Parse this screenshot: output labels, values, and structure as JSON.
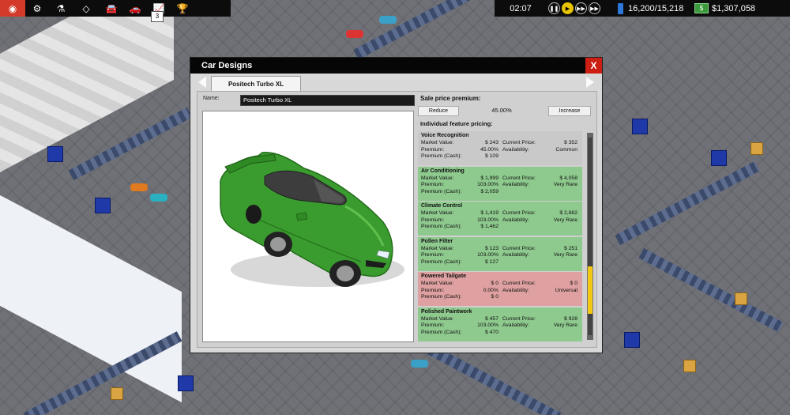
{
  "hud": {
    "badge": "3",
    "time": "02:07",
    "power": "16,200/15,218",
    "cash": "$1,307,058",
    "speed_icons": [
      "pause-icon",
      "play-icon",
      "fast-forward-icon",
      "faster-forward-icon"
    ],
    "left_icons": [
      "logo-icon",
      "gear-icon",
      "research-icon",
      "floor-icon",
      "car-icon",
      "car-design-icon",
      "chart-icon",
      "trophy-icon"
    ]
  },
  "dialog": {
    "title": "Car Designs",
    "close": "X",
    "tab": "Positech Turbo XL",
    "name_label": "Name:",
    "name_value": "Positech Turbo XL",
    "sale_label": "Sale price premium:",
    "reduce": "Reduce",
    "premium": "45.00%",
    "increase": "Increase",
    "features_label": "Individual feature pricing:",
    "car_color": "#3a9c2e"
  },
  "labels": {
    "market": "Market Value:",
    "premium": "Premium:",
    "premium_cash": "Premium (Cash):",
    "current": "Current Price:",
    "availability": "Availability:"
  },
  "features": [
    {
      "name": "Voice Recognition",
      "market": "$ 243",
      "premium": "45.00%",
      "premium_cash": "$ 109",
      "current": "$ 352",
      "availability": "Common",
      "status": "neutral"
    },
    {
      "name": "Air Conditioning",
      "market": "$ 1,999",
      "premium": "103.00%",
      "premium_cash": "$ 2,059",
      "current": "$ 4,058",
      "availability": "Very Rare",
      "status": "good"
    },
    {
      "name": "Climate Control",
      "market": "$ 1,419",
      "premium": "103.00%",
      "premium_cash": "$ 1,462",
      "current": "$ 2,882",
      "availability": "Very Rare",
      "status": "good"
    },
    {
      "name": "Pollen Filter",
      "market": "$ 123",
      "premium": "103.00%",
      "premium_cash": "$ 127",
      "current": "$ 251",
      "availability": "Very Rare",
      "status": "good"
    },
    {
      "name": "Powered Tailgate",
      "market": "$ 0",
      "premium": "0.00%",
      "premium_cash": "$ 0",
      "current": "$ 0",
      "availability": "Universal",
      "status": "bad"
    },
    {
      "name": "Polished Paintwork",
      "market": "$ 457",
      "premium": "103.00%",
      "premium_cash": "$ 470",
      "current": "$ 928",
      "availability": "Very Rare",
      "status": "good"
    }
  ]
}
